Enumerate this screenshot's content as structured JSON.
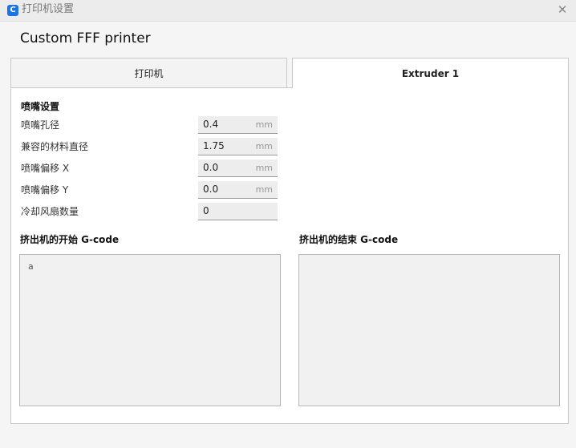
{
  "window": {
    "title": "打印机设置",
    "app_icon": "C",
    "close_glyph": "✕"
  },
  "printer_name": "Custom FFF printer",
  "tabs": [
    {
      "label": "打印机",
      "active": false
    },
    {
      "label": "Extruder 1",
      "active": true
    }
  ],
  "nozzle_settings": {
    "heading": "喷嘴设置",
    "rows": [
      {
        "label": "喷嘴孔径",
        "value": "0.4",
        "unit": "mm"
      },
      {
        "label": "兼容的材料直径",
        "value": "1.75",
        "unit": "mm"
      },
      {
        "label": "喷嘴偏移 X",
        "value": "0.0",
        "unit": "mm"
      },
      {
        "label": "喷嘴偏移 Y",
        "value": "0.0",
        "unit": "mm"
      },
      {
        "label": "冷却风扇数量",
        "value": "0",
        "unit": ""
      }
    ]
  },
  "start_gcode": {
    "label": "挤出机的开始 G-code",
    "value": "a"
  },
  "end_gcode": {
    "label": "挤出机的结束 G-code",
    "value": ""
  },
  "colors": {
    "accent": "#1a73e8",
    "field_bg": "#ededed",
    "panel_bg": "#ffffff"
  }
}
